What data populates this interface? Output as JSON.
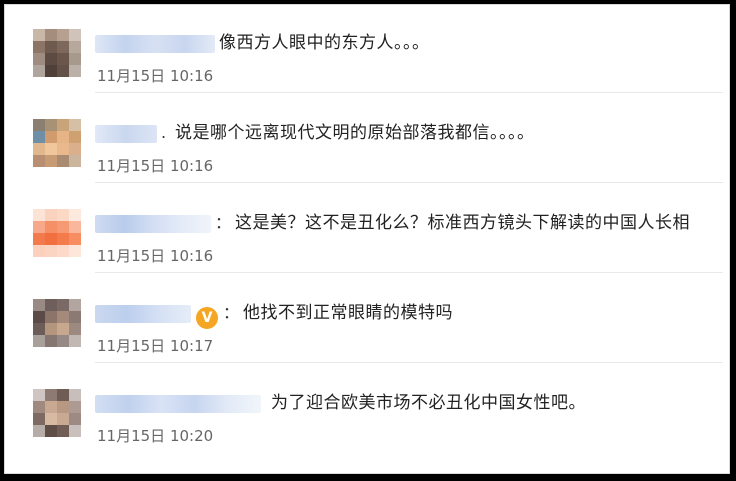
{
  "comments": [
    {
      "text": "像西方人眼中的东方人。。。",
      "time": "11月15日 10:16"
    },
    {
      "sep": ".",
      "text": "说是哪个远离现代文明的原始部落我都信。。。。",
      "time": "11月15日 10:16"
    },
    {
      "sep": "：",
      "text": "这是美？这不是丑化么？标准西方镜头下解读的中国人长相",
      "time": "11月15日 10:16"
    },
    {
      "sep": "：",
      "text": "他找不到正常眼睛的模特吗",
      "time": "11月15日 10:17",
      "badge": "V"
    },
    {
      "text": "为了迎合欧美市场不必丑化中国女性吧。",
      "time": "11月15日 10:20"
    }
  ],
  "colors": {
    "accent": "#f5a623",
    "name_blur": "#c9d7ef"
  }
}
